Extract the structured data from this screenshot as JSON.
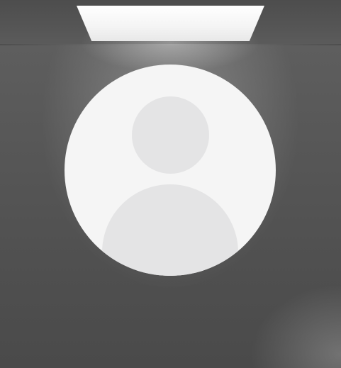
{
  "image": {
    "subject": "default-user-avatar",
    "avatar_background_color": "#f5f5f5",
    "avatar_figure_color": "#e4e4e5",
    "wall_color": "#5a5a5a",
    "light_color": "#ffffff"
  }
}
